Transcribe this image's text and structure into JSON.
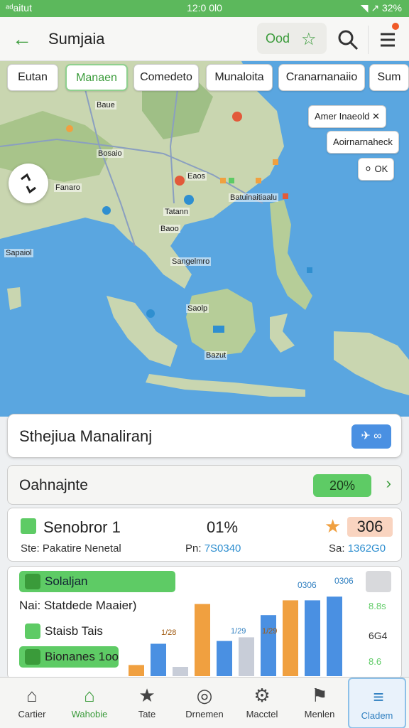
{
  "status_bar": {
    "left": "ᵃᵈaitut",
    "time": "12:0 0l0",
    "right": "◥ ↗ 32%"
  },
  "app_bar": {
    "title": "Sumjaia",
    "pill_label": "Ood",
    "notification": true
  },
  "chips": [
    "Eutan",
    "Manaen",
    "Comedeto",
    "Munaloita",
    "Cranarnanaiio",
    "Sum"
  ],
  "active_chip": 1,
  "map": {
    "side_buttons": [
      "Amer Inaeold",
      "Aoirnarnaheck",
      "OK"
    ],
    "labels": [
      "Baue",
      "Bosaio",
      "Fanaro",
      "Sapaiol",
      "Eaos",
      "Baoo",
      "Sangelmro",
      "Tatann",
      "Saolp",
      "Bazut",
      "Batuinaitiaalu"
    ]
  },
  "search_card": {
    "title": "Sthejiua Manaliranj"
  },
  "overview": {
    "title": "Oahnajnte",
    "percent": "20%"
  },
  "stats": {
    "name": "Senobror 1",
    "mid": "01%",
    "highlight": "306",
    "sub_left_label": "Ste:",
    "sub_left_value": "Pakatire Nenetal",
    "sub_mid_label": "Pn:",
    "sub_mid_value": "7S0340",
    "sub_right_label": "Sa:",
    "sub_right_value": "1362G0"
  },
  "chart_data": {
    "type": "bar",
    "legend": [
      {
        "name": "Solaljan",
        "color": "#5ecb65"
      },
      {
        "name": "Nai: Statdede Maaier)",
        "color": "#ffffff"
      },
      {
        "name": "Staisb Tais",
        "color": "#5ecb65"
      },
      {
        "name": "Bionanes 1oo",
        "color": "#5ecb65"
      }
    ],
    "top_labels": [
      "0306",
      "0306"
    ],
    "bar_labels": [
      "1/28",
      "1/29",
      "1/29"
    ],
    "right_ticks": [
      "8.8s",
      "6G4",
      "8.6"
    ],
    "bars": [
      {
        "color": "#f0a040",
        "value": 12
      },
      {
        "color": "#4a90e2",
        "value": 35
      },
      {
        "color": "#c8cdd8",
        "value": 10
      },
      {
        "color": "#f0a040",
        "value": 78
      },
      {
        "color": "#4a90e2",
        "value": 38
      },
      {
        "color": "#c8cdd8",
        "value": 42
      },
      {
        "color": "#4a90e2",
        "value": 66
      },
      {
        "color": "#f0a040",
        "value": 82
      },
      {
        "color": "#4a90e2",
        "value": 82
      },
      {
        "color": "#4a90e2",
        "value": 86
      }
    ]
  },
  "nav": [
    "Cartier",
    "Wahobie",
    "Tate",
    "Drnemen",
    "Macctel",
    "Menlen",
    "Cladem"
  ],
  "nav_active": 1,
  "nav_selected": 6,
  "colors": {
    "accent_green": "#3a9b3a",
    "sea": "#5aa6e0",
    "land": "#c9d6b0"
  }
}
